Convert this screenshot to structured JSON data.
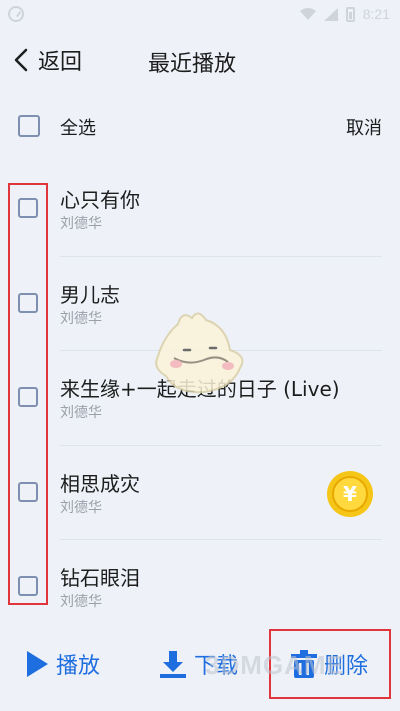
{
  "status_bar": {
    "time": "8:21",
    "icons": [
      "alarm-icon",
      "wifi-icon",
      "signal-icon",
      "battery-icon"
    ]
  },
  "header": {
    "back_label": "返回",
    "title": "最近播放"
  },
  "selection": {
    "select_all_label": "全选",
    "cancel_label": "取消"
  },
  "songs": [
    {
      "title": "心只有你",
      "artist": "刘德华",
      "checked": false
    },
    {
      "title": "男儿志",
      "artist": "刘德华",
      "checked": false
    },
    {
      "title": "来生缘+一起走过的日子 (Live)",
      "artist": "刘德华",
      "checked": false
    },
    {
      "title": "相思成灾",
      "artist": "刘德华",
      "checked": false
    },
    {
      "title": "钻石眼泪",
      "artist": "刘德华",
      "checked": false
    }
  ],
  "bottom_actions": {
    "play_label": "播放",
    "download_label": "下载",
    "delete_label": "删除"
  },
  "watermark": "3DMGAME",
  "colors": {
    "accent": "#1f6ee0",
    "annotation": "#e0363b",
    "background": "#eef2f8",
    "coin": "#f5c518"
  }
}
